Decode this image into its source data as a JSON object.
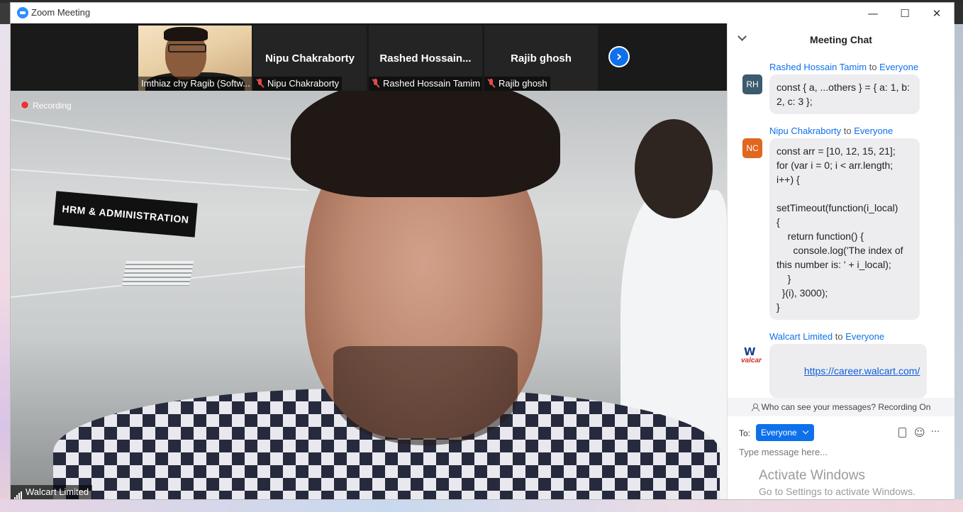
{
  "window": {
    "title": "Zoom Meeting",
    "minimize": "—",
    "maximize": "☐",
    "close": "✕"
  },
  "thumbnails": [
    {
      "name": "Imthiaz chy Ragib (Softw...",
      "muted": false,
      "video": true
    },
    {
      "display_name": "Nipu Chakraborty",
      "name": "Nipu Chakraborty",
      "muted": true
    },
    {
      "display_name": "Rashed  Hossain...",
      "name": "Rashed Hossain Tamim",
      "muted": true
    },
    {
      "display_name": "Rajib ghosh",
      "name": "Rajib ghosh",
      "muted": true
    }
  ],
  "next_page_icon": "›",
  "main_video": {
    "recording_label": "Recording",
    "speaker_name": "Walcart Limited",
    "sign_text": "HRM & ADMINISTRATION"
  },
  "chat": {
    "title": "Meeting Chat",
    "messages": [
      {
        "sender": "Rashed Hossain Tamim",
        "to_word": "to",
        "recipient": "Everyone",
        "avatar": "RH",
        "avatar_color": "#3d5a6e",
        "text": "const { a, ...others } = { a: 1, b: 2, c: 3 };"
      },
      {
        "sender": "Nipu Chakraborty",
        "to_word": "to",
        "recipient": "Everyone",
        "avatar": "NC",
        "avatar_color": "#e0671f",
        "text": "const arr = [10, 12, 15, 21];\nfor (var i = 0; i < arr.length; i++) {\n\nsetTimeout(function(i_local)\n{\n    return function() {\n      console.log('The index of this number is: ' + i_local);\n    }\n  }(i), 3000);\n}"
      },
      {
        "sender": "Walcart Limited",
        "to_word": "to",
        "recipient": "Everyone",
        "avatar_logo": "valcar",
        "text": "https://career.walcart.com/"
      }
    ],
    "privacy_text": "Who can see your messages? Recording On",
    "to_label": "To:",
    "recipient_select": "Everyone",
    "input_placeholder": "Type message here...",
    "more_icon": "···",
    "emoji_icon": "☺"
  },
  "watermark": {
    "line1": "Activate Windows",
    "line2": "Go to Settings to activate Windows."
  },
  "colors": {
    "accent": "#0e71eb",
    "stage_bg": "#1a1a1a"
  }
}
